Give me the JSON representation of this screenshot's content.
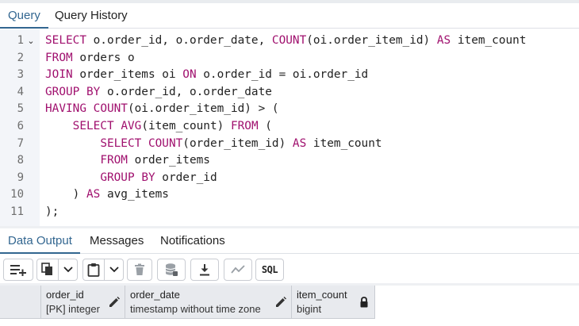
{
  "query_tabs": [
    {
      "label": "Query",
      "active": true
    },
    {
      "label": "Query History",
      "active": false
    }
  ],
  "editor": {
    "line_numbers": [
      "1",
      "2",
      "3",
      "4",
      "5",
      "6",
      "7",
      "8",
      "9",
      "10",
      "11"
    ],
    "fold_marker": "⌄",
    "lines": [
      "SELECT o.order_id, o.order_date, COUNT(oi.order_item_id) AS item_count",
      "FROM orders o",
      "JOIN order_items oi ON o.order_id = oi.order_id",
      "GROUP BY o.order_id, o.order_date",
      "HAVING COUNT(oi.order_item_id) > (",
      "    SELECT AVG(item_count) FROM (",
      "        SELECT COUNT(order_item_id) AS item_count",
      "        FROM order_items",
      "        GROUP BY order_id",
      "    ) AS avg_items",
      ");"
    ]
  },
  "output_tabs": [
    {
      "label": "Data Output",
      "active": true
    },
    {
      "label": "Messages",
      "active": false
    },
    {
      "label": "Notifications",
      "active": false
    }
  ],
  "toolbar": {
    "buttons": [
      "add-row-icon",
      "copy-icon",
      "chevron-down-icon",
      "paste-icon",
      "chevron-down-icon",
      "delete-icon",
      "save-data-icon",
      "download-icon",
      "graph-icon",
      "sql-icon"
    ],
    "sql_label": "SQL"
  },
  "grid": {
    "columns": [
      {
        "name": "order_id",
        "type": "[PK] integer",
        "icon": "edit-icon"
      },
      {
        "name": "order_date",
        "type": "timestamp without time zone",
        "icon": "edit-icon"
      },
      {
        "name": "item_count",
        "type": "bigint",
        "icon": "lock-icon"
      }
    ]
  },
  "colors": {
    "accent": "#326690",
    "keyword": "#a0106e",
    "gutter": "#f3f5f9",
    "header_bg": "#e8eaee"
  }
}
